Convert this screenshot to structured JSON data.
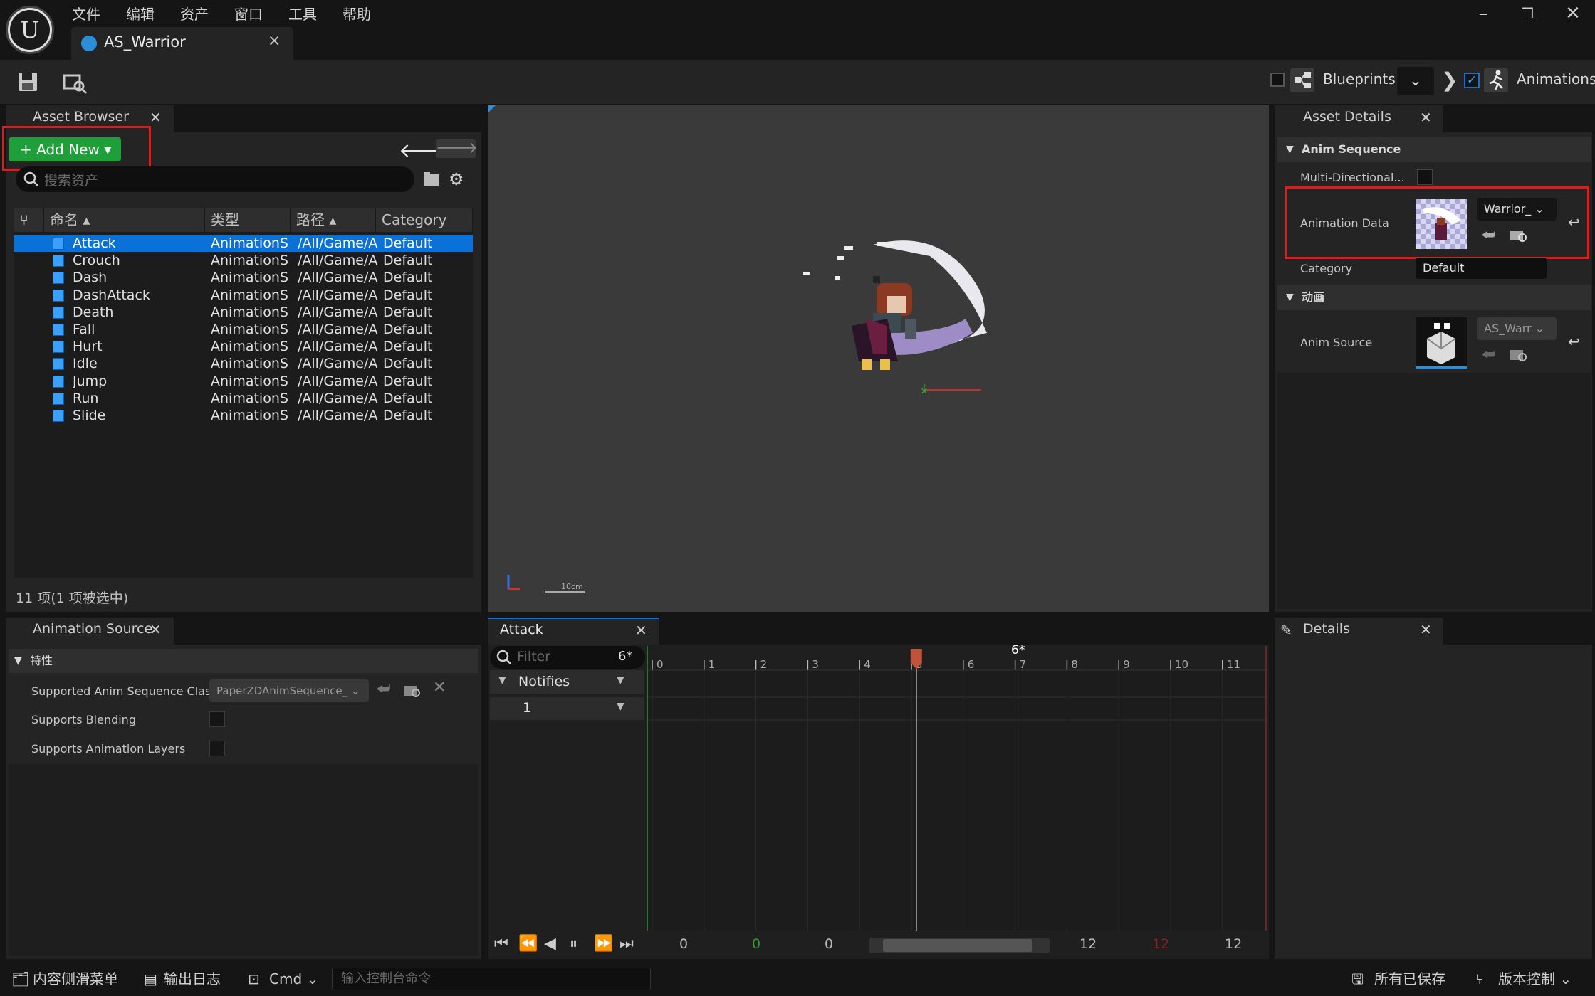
{
  "menu": [
    "文件",
    "编辑",
    "资产",
    "窗口",
    "工具",
    "帮助"
  ],
  "tab": {
    "title": "AS_Warrior",
    "close": "×"
  },
  "toolbar": {
    "blueprints": "Blueprints",
    "animations": "Animations"
  },
  "asset_browser": {
    "tab_label": "Asset Browser",
    "add_new": "Add New",
    "search_placeholder": "搜索资产",
    "columns": [
      "命名",
      "类型",
      "路径",
      "Category"
    ],
    "rows": [
      {
        "name": "Attack",
        "type": "AnimationS",
        "path": "/All/Game/A",
        "category": "Default"
      },
      {
        "name": "Crouch",
        "type": "AnimationS",
        "path": "/All/Game/A",
        "category": "Default"
      },
      {
        "name": "Dash",
        "type": "AnimationS",
        "path": "/All/Game/A",
        "category": "Default"
      },
      {
        "name": "DashAttack",
        "type": "AnimationS",
        "path": "/All/Game/A",
        "category": "Default"
      },
      {
        "name": "Death",
        "type": "AnimationS",
        "path": "/All/Game/A",
        "category": "Default"
      },
      {
        "name": "Fall",
        "type": "AnimationS",
        "path": "/All/Game/A",
        "category": "Default"
      },
      {
        "name": "Hurt",
        "type": "AnimationS",
        "path": "/All/Game/A",
        "category": "Default"
      },
      {
        "name": "Idle",
        "type": "AnimationS",
        "path": "/All/Game/A",
        "category": "Default"
      },
      {
        "name": "Jump",
        "type": "AnimationS",
        "path": "/All/Game/A",
        "category": "Default"
      },
      {
        "name": "Run",
        "type": "AnimationS",
        "path": "/All/Game/A",
        "category": "Default"
      },
      {
        "name": "Slide",
        "type": "AnimationS",
        "path": "/All/Game/A",
        "category": "Default"
      }
    ],
    "selected_index": 0,
    "count_text": "11 项(1 项被选中)"
  },
  "viewport": {
    "scale_label": "10cm"
  },
  "asset_details": {
    "tab_label": "Asset Details",
    "section1": "Anim Sequence",
    "multi_directional": "Multi-Directional...",
    "animation_data": "Animation Data",
    "animation_data_value": "Warrior_",
    "category_label": "Category",
    "category_value": "Default",
    "section2": "动画",
    "anim_source": "Anim Source",
    "anim_source_value": "AS_Warr"
  },
  "animation_source": {
    "tab_label": "Animation Source",
    "section": "特性",
    "supported_class_label": "Supported Anim Sequence Class",
    "supported_class_value": "PaperZDAnimSequence_",
    "supports_blending": "Supports Blending",
    "supports_layers": "Supports Animation Layers"
  },
  "timeline": {
    "tab_label": "Attack",
    "filter_placeholder": "Filter",
    "frame_marker": "6*",
    "notifies": "Notifies",
    "track_1": "1",
    "ticks": [
      "0",
      "1",
      "2",
      "3",
      "4",
      "5",
      "6",
      "7",
      "8",
      "9",
      "10",
      "11"
    ],
    "playhead_frame": 6,
    "range_start": "0",
    "range_start_green": "0",
    "range_current": "0",
    "range_end": "12",
    "range_end_red": "12",
    "range_end2": "12"
  },
  "details": {
    "tab_label": "Details"
  },
  "status": {
    "content_drawer": "内容侧滑菜单",
    "output_log": "输出日志",
    "cmd": "Cmd",
    "console_placeholder": "输入控制台命令",
    "all_saved": "所有已保存",
    "version_control": "版本控制"
  },
  "colors": {
    "accent": "#0a71d8",
    "add_new": "#1f9f3a",
    "highlight": "#e01b1b",
    "playhead": "#c0543a"
  }
}
